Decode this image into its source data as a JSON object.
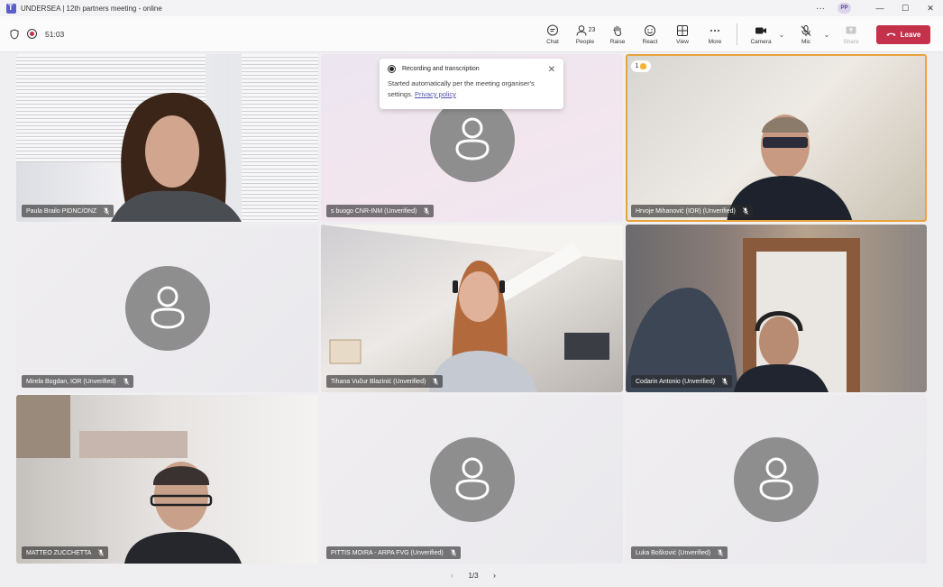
{
  "window": {
    "title": "UNDERSEA | 12th partners meeting - online",
    "more": "···",
    "avatar_initials": "PP",
    "minimize": "—",
    "maximize": "☐",
    "close": "✕"
  },
  "toolbar": {
    "timer": "51:03",
    "chat": "Chat",
    "people": "People",
    "people_count": "23",
    "raise": "Raise",
    "react": "React",
    "view": "View",
    "more": "More",
    "camera": "Camera",
    "mic": "Mic",
    "share": "Share",
    "leave": "Leave"
  },
  "popup": {
    "title": "Recording and transcription",
    "body": "Started automatically per the meeting organiser's settings.",
    "link": "Privacy policy",
    "close": "✕"
  },
  "participants": [
    {
      "name": "Paula Brailo PIDNC/ONZ"
    },
    {
      "name": "s buogo CNR-INM (Unverified)"
    },
    {
      "name": "Hrvoje Mihanović (IOR) (Unverified)",
      "badge": "1"
    },
    {
      "name": "Mirela Bogdan, IOR (Unverified)"
    },
    {
      "name": "Tihana Vučur Blazinić (Unverified)"
    },
    {
      "name": "Codarin Antonio (Unverified)"
    },
    {
      "name": "MATTEO ZUCCHETTA"
    },
    {
      "name": "PITTIS MOIRA - ARPA FVG (Unverified)"
    },
    {
      "name": "Luka Bošković (Unverified)"
    }
  ],
  "pager": {
    "label": "1/3",
    "prev": "‹",
    "next": "›"
  },
  "colors": {
    "leave": "#c4314b",
    "active_speaker_border": "#e8a33b",
    "link": "#4f52b2"
  }
}
